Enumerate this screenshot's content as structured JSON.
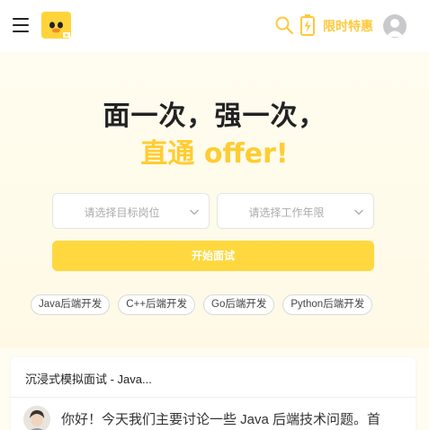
{
  "header": {
    "menu_icon": "hamburger-icon",
    "logo_icon": "duck-logo-icon",
    "search_icon": "search-icon",
    "promo_icon": "battery-bolt-icon",
    "promo_label": "限时特惠",
    "avatar_icon": "user-avatar-icon",
    "accent_color": "#ffc93a"
  },
  "hero": {
    "headline_line1": "面一次，强一次，",
    "headline_highlight": "直通 offer!",
    "highlight_color": "#ffcc32",
    "position_select": {
      "placeholder": "请选择目标岗位",
      "icon": "chevron-down-icon"
    },
    "experience_select": {
      "placeholder": "请选择工作年限",
      "icon": "chevron-down-icon"
    },
    "start_button": "开始面试",
    "button_color": "#ffd83f",
    "tags": [
      "Java后端开发",
      "C++后端开发",
      "Go后端开发",
      "Python后端开发"
    ]
  },
  "session": {
    "title": "沉浸式模拟面试 - Java...",
    "message": "你好！今天我们主要讨论一些 Java 后端技术问题。首",
    "avatar_icon": "interviewer-avatar-icon"
  }
}
